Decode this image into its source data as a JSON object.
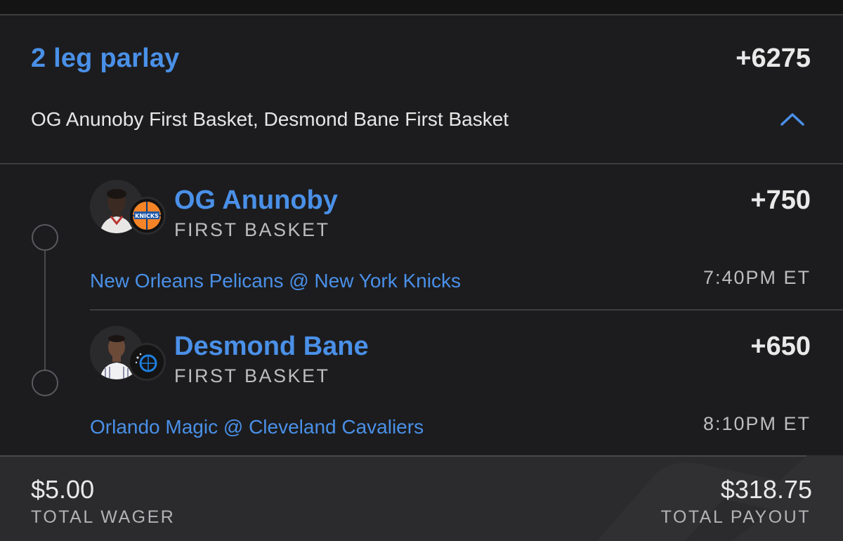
{
  "parlay": {
    "title": "2 leg parlay",
    "odds": "+6275",
    "description": "OG Anunoby First Basket, Desmond Bane First Basket"
  },
  "legs": [
    {
      "player": "OG Anunoby",
      "market": "FIRST BASKET",
      "odds": "+750",
      "matchup": "New Orleans Pelicans @ New York Knicks",
      "time": "7:40PM ET",
      "team_logo": "knicks-logo-icon"
    },
    {
      "player": "Desmond Bane",
      "market": "FIRST BASKET",
      "odds": "+650",
      "matchup": "Orlando Magic @ Cleveland Cavaliers",
      "time": "8:10PM ET",
      "team_logo": "magic-logo-icon"
    }
  ],
  "totals": {
    "wager_amount": "$5.00",
    "wager_label": "TOTAL WAGER",
    "payout_amount": "$318.75",
    "payout_label": "TOTAL PAYOUT"
  },
  "colors": {
    "accent": "#4a90e8",
    "background": "#1c1c1e",
    "footer": "#2b2b2e",
    "text": "#e9e9e9",
    "muted": "#bdbdc0"
  },
  "icons": {
    "collapse": "chevron-up-icon",
    "timeline": "timeline-dot-icon"
  }
}
